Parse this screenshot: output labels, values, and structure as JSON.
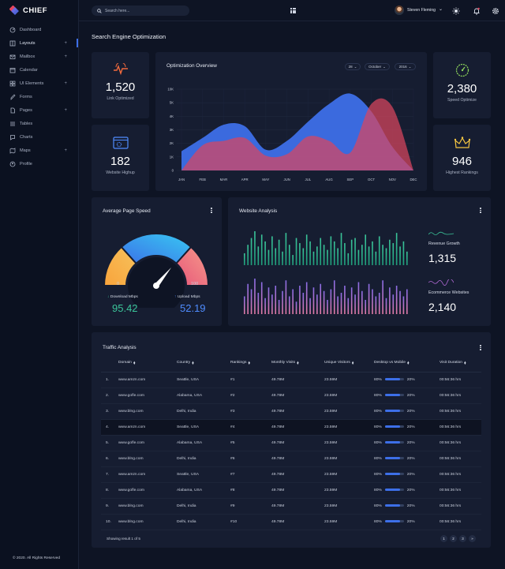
{
  "app": {
    "name": "CHIEF",
    "copyright": "© 2020. All Rights Reserved"
  },
  "sidebar": {
    "items": [
      {
        "label": "Dashboard",
        "icon": "dashboard-icon",
        "expandable": false
      },
      {
        "label": "Layouts",
        "icon": "layouts-icon",
        "expandable": true
      },
      {
        "label": "Mailbox",
        "icon": "mail-icon",
        "expandable": true
      },
      {
        "label": "Calendar",
        "icon": "calendar-icon",
        "expandable": false
      },
      {
        "label": "UI Elements",
        "icon": "ui-elements-icon",
        "expandable": true
      },
      {
        "label": "Forms",
        "icon": "forms-icon",
        "expandable": false
      },
      {
        "label": "Pages",
        "icon": "pages-icon",
        "expandable": true
      },
      {
        "label": "Tables",
        "icon": "tables-icon",
        "expandable": false
      },
      {
        "label": "Charts",
        "icon": "charts-icon",
        "expandable": false
      },
      {
        "label": "Maps",
        "icon": "maps-icon",
        "expandable": true
      },
      {
        "label": "Profile",
        "icon": "profile-icon",
        "expandable": false
      }
    ],
    "active": "Layouts",
    "plus_symbol": "+"
  },
  "topbar": {
    "search_placeholder": "Search here...",
    "user_name": "Steven Fleming",
    "caret": "⌄"
  },
  "page": {
    "title": "Search Engine Optimization"
  },
  "stats": {
    "link": {
      "value": "1,520",
      "label": "Link Optimized",
      "icon": "pulse-icon",
      "color": "#f26a3d"
    },
    "website": {
      "value": "182",
      "label": "Website Highup",
      "icon": "browser-gear-icon",
      "color": "#4f8cff"
    },
    "speed": {
      "value": "2,380",
      "label": "Speed Optimize",
      "icon": "speed-gauge-icon",
      "color": "#8ad05a"
    },
    "rankings": {
      "value": "946",
      "label": "Highest Rankings",
      "icon": "crown-icon",
      "color": "#f4c542"
    }
  },
  "optimization": {
    "title": "Optimization Overview",
    "filters": [
      "28",
      "October",
      "2016"
    ],
    "chart_data": {
      "type": "area",
      "title": "Optimization Overview",
      "categories": [
        "JAN",
        "FEB",
        "MAR",
        "APR",
        "MAY",
        "JUN",
        "JUL",
        "AUG",
        "SEP",
        "OCT",
        "NOV",
        "DEC"
      ],
      "y_ticks": [
        "0",
        "1K",
        "2K",
        "3K",
        "4K",
        "5K",
        "10K"
      ],
      "series": [
        {
          "values": [
            1.3,
            2.2,
            3.1,
            3.0,
            1.4,
            2.0,
            3.3,
            4.5,
            5.2,
            4.0,
            1.6,
            0
          ],
          "color": "#3d6fe8"
        },
        {
          "values": [
            0,
            1.7,
            2.0,
            2.2,
            1.0,
            1.1,
            2.3,
            2.0,
            1.2,
            4.5,
            4.3,
            0
          ],
          "color": "#d9455e"
        }
      ],
      "ylim": [
        0,
        5.5
      ]
    }
  },
  "speed": {
    "title": "Average Page Speed",
    "gauge_min": "0",
    "gauge_max": "100",
    "gauge_value": 0.72,
    "download": {
      "label": "Download Mbps",
      "value": "95.42",
      "arrow": "↓",
      "color": "#3bc59a"
    },
    "upload": {
      "label": "Upload Mbps",
      "value": "52.19",
      "arrow": "↑",
      "color": "#4f8cff"
    }
  },
  "website_analysis": {
    "title": "Website Analysis",
    "revenue": {
      "label": "Revenue Growth",
      "value": "1,315"
    },
    "ecommerce": {
      "label": "Ecommerce Websites",
      "value": "2,140"
    },
    "chart_data": [
      {
        "type": "bar",
        "name": "",
        "color": "#3bc59a",
        "values": [
          0.35,
          0.6,
          0.8,
          1.0,
          0.55,
          0.9,
          0.7,
          0.45,
          0.85,
          0.5,
          0.75,
          0.4,
          0.95,
          0.6,
          0.3,
          0.8,
          0.65,
          0.5,
          0.9,
          0.7,
          0.4,
          0.55,
          0.8,
          0.6,
          0.45,
          0.85,
          0.7,
          0.5,
          0.95,
          0.65,
          0.35,
          0.75,
          0.8,
          0.45,
          0.6,
          0.9,
          0.55,
          0.7,
          0.4,
          0.85,
          0.6,
          0.5,
          0.75,
          0.65,
          0.95,
          0.55,
          0.7,
          0.4
        ]
      },
      {
        "type": "bar",
        "name": "",
        "color": "#b36ad6",
        "values": [
          0.5,
          0.85,
          0.7,
          1.0,
          0.6,
          0.9,
          0.45,
          0.75,
          0.55,
          0.8,
          0.4,
          0.65,
          0.95,
          0.5,
          0.7,
          0.35,
          0.8,
          0.6,
          0.9,
          0.45,
          0.75,
          0.55,
          0.85,
          0.65,
          0.4,
          0.7,
          0.95,
          0.5,
          0.6,
          0.8,
          0.45,
          0.75,
          0.55,
          0.9,
          0.65,
          0.4,
          0.85,
          0.7,
          0.5,
          0.6,
          0.95,
          0.45,
          0.75,
          0.55,
          0.8,
          0.65,
          0.5,
          0.7
        ]
      }
    ]
  },
  "traffic": {
    "title": "Traffic Analysis",
    "columns": [
      "Domain",
      "Country",
      "Rankings",
      "Monthly Visits",
      "Unique Visitors",
      "Desktop vs Mobile",
      "Visit Duration"
    ],
    "rows": [
      {
        "n": "1.",
        "domain": "www.amzn.com",
        "country": "Seattle, USA",
        "rank": "#1",
        "visits": "49.78M",
        "unique": "23.59M",
        "desktop": "80%",
        "mobile": "20%",
        "dm_fill": 0.8,
        "duration": "00:56:36 hrs"
      },
      {
        "n": "2.",
        "domain": "www.gofle.com",
        "country": "Alabama, USA",
        "rank": "#2",
        "visits": "49.78M",
        "unique": "23.59M",
        "desktop": "80%",
        "mobile": "20%",
        "dm_fill": 0.8,
        "duration": "00:56:36 hrs"
      },
      {
        "n": "3.",
        "domain": "www.blng.com",
        "country": "Delhi, India",
        "rank": "#3",
        "visits": "49.78M",
        "unique": "23.59M",
        "desktop": "80%",
        "mobile": "20%",
        "dm_fill": 0.8,
        "duration": "00:56:36 hrs"
      },
      {
        "n": "4.",
        "domain": "www.amzn.com",
        "country": "Seattle, USA",
        "rank": "#4",
        "visits": "49.78M",
        "unique": "23.59M",
        "desktop": "80%",
        "mobile": "20%",
        "dm_fill": 0.8,
        "duration": "00:56:36 hrs"
      },
      {
        "n": "5.",
        "domain": "www.gofle.com",
        "country": "Alabama, USA",
        "rank": "#5",
        "visits": "49.78M",
        "unique": "23.59M",
        "desktop": "80%",
        "mobile": "20%",
        "dm_fill": 0.8,
        "duration": "00:56:36 hrs"
      },
      {
        "n": "6.",
        "domain": "www.blng.com",
        "country": "Delhi, India",
        "rank": "#6",
        "visits": "49.78M",
        "unique": "23.59M",
        "desktop": "80%",
        "mobile": "20%",
        "dm_fill": 0.8,
        "duration": "00:56:36 hrs"
      },
      {
        "n": "7.",
        "domain": "www.amzn.com",
        "country": "Seattle, USA",
        "rank": "#7",
        "visits": "49.78M",
        "unique": "23.59M",
        "desktop": "80%",
        "mobile": "20%",
        "dm_fill": 0.8,
        "duration": "00:56:36 hrs"
      },
      {
        "n": "8.",
        "domain": "www.gofle.com",
        "country": "Alabama, USA",
        "rank": "#8",
        "visits": "49.78M",
        "unique": "23.59M",
        "desktop": "80%",
        "mobile": "20%",
        "dm_fill": 0.8,
        "duration": "00:56:36 hrs"
      },
      {
        "n": "9.",
        "domain": "www.blng.com",
        "country": "Delhi, India",
        "rank": "#9",
        "visits": "49.78M",
        "unique": "23.59M",
        "desktop": "80%",
        "mobile": "20%",
        "dm_fill": 0.8,
        "duration": "00:56:36 hrs"
      },
      {
        "n": "10.",
        "domain": "www.blng.com",
        "country": "Delhi, India",
        "rank": "#10",
        "visits": "49.78M",
        "unique": "23.59M",
        "desktop": "80%",
        "mobile": "20%",
        "dm_fill": 0.8,
        "duration": "00:56:36 hrs"
      }
    ],
    "highlight_row": 3,
    "footer": "Showing result 1 of 5",
    "pages": [
      "1",
      "2",
      "3",
      "»"
    ]
  }
}
